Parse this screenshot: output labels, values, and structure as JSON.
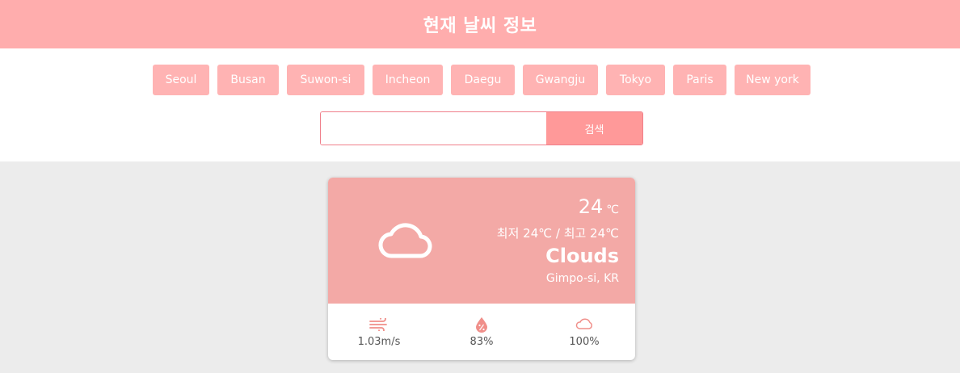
{
  "header": {
    "title": "현재 날씨 정보"
  },
  "cities": [
    "Seoul",
    "Busan",
    "Suwon-si",
    "Incheon",
    "Daegu",
    "Gwangju",
    "Tokyo",
    "Paris",
    "New york"
  ],
  "search": {
    "value": "",
    "button_label": "검색"
  },
  "weather": {
    "icon": "cloud-icon",
    "temp": "24",
    "unit": "℃",
    "minmax": "최저 24℃ / 최고 24℃",
    "description": "Clouds",
    "location": "Gimpo-si, KR",
    "wind": "1.03m/s",
    "humidity": "83%",
    "cloudiness": "100%"
  },
  "colors": {
    "header": "#ffadad",
    "city_button": "#ffb3b3",
    "search_button": "#ff9999",
    "card_top": "#f3a9a6",
    "accent": "#f08f8a"
  }
}
